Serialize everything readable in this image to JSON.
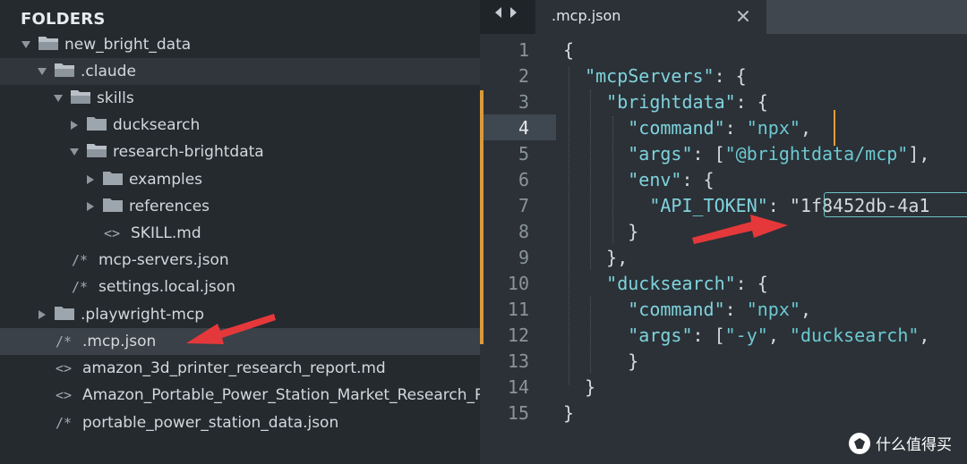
{
  "sidebar": {
    "title": "FOLDERS",
    "items": [
      {
        "label": "new_bright_data",
        "type": "folder-open"
      },
      {
        "label": ".claude",
        "type": "folder-open"
      },
      {
        "label": "skills",
        "type": "folder-open"
      },
      {
        "label": "ducksearch",
        "type": "folder-closed"
      },
      {
        "label": "research-brightdata",
        "type": "folder-open"
      },
      {
        "label": "examples",
        "type": "folder-closed"
      },
      {
        "label": "references",
        "type": "folder-closed"
      },
      {
        "label": "SKILL.md",
        "type": "file-markup",
        "glyph": "<>"
      },
      {
        "label": "mcp-servers.json",
        "type": "file-json",
        "glyph": "/*"
      },
      {
        "label": "settings.local.json",
        "type": "file-json",
        "glyph": "/*"
      },
      {
        "label": ".playwright-mcp",
        "type": "folder-closed"
      },
      {
        "label": ".mcp.json",
        "type": "file-json",
        "glyph": "/*"
      },
      {
        "label": "amazon_3d_printer_research_report.md",
        "type": "file-markup",
        "glyph": "<>"
      },
      {
        "label": "Amazon_Portable_Power_Station_Market_Research_Rep",
        "type": "file-markup",
        "glyph": "<>"
      },
      {
        "label": "portable_power_station_data.json",
        "type": "file-json",
        "glyph": "/*"
      }
    ]
  },
  "editor": {
    "tab_title": ".mcp.json",
    "current_line": 4,
    "lines": [
      {
        "n": "1",
        "text": "{"
      },
      {
        "n": "2",
        "text": "  \"mcpServers\": {"
      },
      {
        "n": "3",
        "text": "    \"brightdata\": {"
      },
      {
        "n": "4",
        "text": "      \"command\": \"npx\","
      },
      {
        "n": "5",
        "text": "      \"args\": [\"@brightdata/mcp\"],"
      },
      {
        "n": "6",
        "text": "      \"env\": {"
      },
      {
        "n": "7",
        "text": "        \"API_TOKEN\": \"1f8452db-4a1"
      },
      {
        "n": "8",
        "text": "      }"
      },
      {
        "n": "9",
        "text": "    },"
      },
      {
        "n": "10",
        "text": "    \"ducksearch\": {"
      },
      {
        "n": "11",
        "text": "      \"command\": \"npx\","
      },
      {
        "n": "12",
        "text": "      \"args\": [\"-y\", \"ducksearch\","
      },
      {
        "n": "13",
        "text": "      }"
      },
      {
        "n": "14",
        "text": "  }"
      },
      {
        "n": "15",
        "text": "}"
      }
    ]
  },
  "watermark": {
    "text": "什么值得买",
    "logo_char": "值"
  },
  "colors": {
    "arrow": "#e5383b",
    "accent": "#d99a3a",
    "string": "#6cc9d1"
  },
  "icons": [
    "folder-open-icon",
    "folder-closed-icon",
    "chevron-right-icon",
    "chevron-down-icon",
    "back-arrow-icon",
    "forward-arrow-icon",
    "close-icon"
  ]
}
